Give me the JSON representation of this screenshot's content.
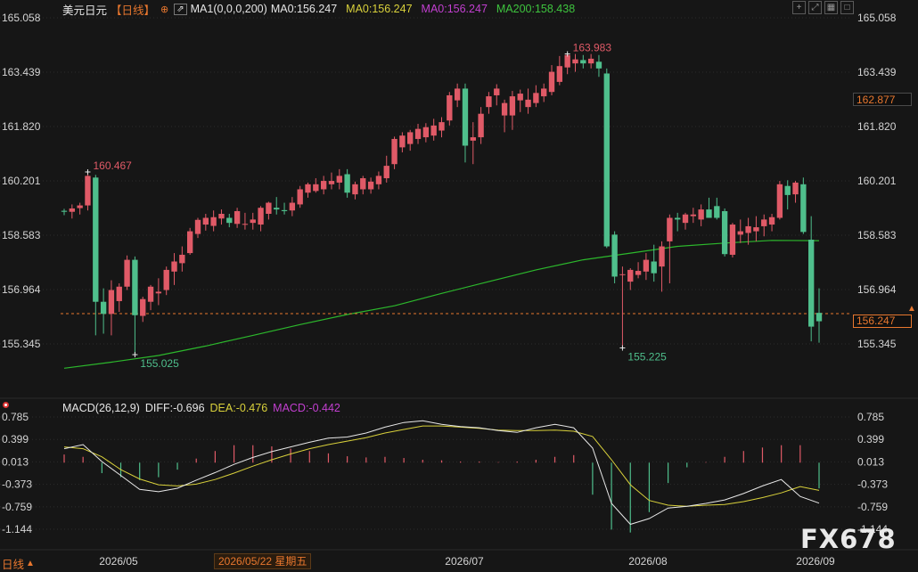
{
  "header": {
    "symbol": "美元日元",
    "period_label": "【日线】",
    "ma_params": "MA1(0,0,0,200)",
    "ma0": "MA0:156.247",
    "ma50": "MA0:156.247",
    "ma100": "MA0:156.247",
    "ma200": "MA200:158.438",
    "ma50_text": "MA0:156.247"
  },
  "header_items": [
    "MA0:156.247",
    "MA0:156.247",
    "MA0:156.247",
    "MA200:158.438"
  ],
  "header_colors": [
    "#e6e6e6",
    "#d9d13b",
    "#c23fd0",
    "#3ec43e"
  ],
  "macd_header": {
    "title": "MACD(26,12,9)",
    "diff": "DIFF:-0.696",
    "dea": "DEA:-0.476",
    "macd": "MACD:-0.442"
  },
  "footer": {
    "period": "日线",
    "crosshair_date": "2026/05/22 星期五",
    "watermark": "FX678"
  },
  "price_badges": {
    "last": "162.877",
    "current": "156.247"
  },
  "colors": {
    "background": "#161616",
    "up": "#e05a67",
    "down": "#4fbf8c",
    "ma200": "#2cb82c",
    "diff": "#e8e8e8",
    "dea": "#d9d13b",
    "accent": "#e8772e",
    "grid": "#2c2c2c"
  },
  "toolbar_icons": [
    "crosshair-icon",
    "expand-icon",
    "layout-icon",
    "maximize-icon"
  ],
  "chart_data": [
    {
      "type": "candlestick",
      "title": "美元日元 日线",
      "y_ticks": [
        165.058,
        163.439,
        161.82,
        160.201,
        158.583,
        156.964,
        155.345
      ],
      "ylim": [
        155.345,
        165.058
      ],
      "x_ticks": [
        "2026/05",
        "2026/07",
        "2026/08",
        "2026/09"
      ],
      "annotations": [
        {
          "label": "160.467",
          "value": 160.467,
          "kind": "high"
        },
        {
          "label": "155.025",
          "value": 155.025,
          "kind": "low"
        },
        {
          "label": "163.983",
          "value": 163.983,
          "kind": "high"
        },
        {
          "label": "155.225",
          "value": 155.225,
          "kind": "low"
        }
      ],
      "current_price": 156.247,
      "last_price_marker": 162.877,
      "candles": [
        [
          159.31,
          159.37,
          159.18,
          159.28
        ],
        [
          159.28,
          159.5,
          159.08,
          159.38
        ],
        [
          159.39,
          159.55,
          159.2,
          159.47
        ],
        [
          159.47,
          160.47,
          159.32,
          160.35
        ],
        [
          160.3,
          160.38,
          155.6,
          156.6
        ],
        [
          156.6,
          157.0,
          155.65,
          156.24
        ],
        [
          156.24,
          157.24,
          155.6,
          156.95
        ],
        [
          156.62,
          157.15,
          156.3,
          157.05
        ],
        [
          157.05,
          157.98,
          156.95,
          157.85
        ],
        [
          157.85,
          157.95,
          155.02,
          156.2
        ],
        [
          156.18,
          156.75,
          156.0,
          156.68
        ],
        [
          156.6,
          157.1,
          156.35,
          157.05
        ],
        [
          156.85,
          157.3,
          156.5,
          156.9
        ],
        [
          156.95,
          157.65,
          156.8,
          157.55
        ],
        [
          157.5,
          158.05,
          157.1,
          157.8
        ],
        [
          157.75,
          158.25,
          157.5,
          158.0
        ],
        [
          158.05,
          158.8,
          158.0,
          158.7
        ],
        [
          158.62,
          159.1,
          158.5,
          159.04
        ],
        [
          158.9,
          159.22,
          158.72,
          159.1
        ],
        [
          158.86,
          159.32,
          158.7,
          159.12
        ],
        [
          159.08,
          159.35,
          158.9,
          159.22
        ],
        [
          159.1,
          159.22,
          158.82,
          158.95
        ],
        [
          158.92,
          159.4,
          158.8,
          159.3
        ],
        [
          158.9,
          159.25,
          158.75,
          158.92
        ],
        [
          158.95,
          159.25,
          158.75,
          159.05
        ],
        [
          158.9,
          159.45,
          158.7,
          159.4
        ],
        [
          159.22,
          159.58,
          159.05,
          159.55
        ],
        [
          159.4,
          159.72,
          159.2,
          159.35
        ],
        [
          159.33,
          159.55,
          159.2,
          159.3
        ],
        [
          159.32,
          159.72,
          159.15,
          159.55
        ],
        [
          159.5,
          160.05,
          159.4,
          159.95
        ],
        [
          159.85,
          160.15,
          159.7,
          160.1
        ],
        [
          159.9,
          160.28,
          159.85,
          160.1
        ],
        [
          159.95,
          160.35,
          159.8,
          160.2
        ],
        [
          160.1,
          160.45,
          159.95,
          160.2
        ],
        [
          160.15,
          160.55,
          159.95,
          160.35
        ],
        [
          160.4,
          160.55,
          159.7,
          159.85
        ],
        [
          159.8,
          160.18,
          159.65,
          160.1
        ],
        [
          159.95,
          160.35,
          159.8,
          160.28
        ],
        [
          159.95,
          160.3,
          159.82,
          160.18
        ],
        [
          160.1,
          160.48,
          159.95,
          160.35
        ],
        [
          160.28,
          160.95,
          160.15,
          160.65
        ],
        [
          160.7,
          161.52,
          160.55,
          161.45
        ],
        [
          161.2,
          161.65,
          161.05,
          161.55
        ],
        [
          161.3,
          161.72,
          161.1,
          161.65
        ],
        [
          161.45,
          161.9,
          161.3,
          161.75
        ],
        [
          161.5,
          161.92,
          161.35,
          161.8
        ],
        [
          161.55,
          162.05,
          161.4,
          161.85
        ],
        [
          161.7,
          162.1,
          161.5,
          161.95
        ],
        [
          162.0,
          162.85,
          161.85,
          162.75
        ],
        [
          162.6,
          163.1,
          162.4,
          162.95
        ],
        [
          162.95,
          163.1,
          160.75,
          161.25
        ],
        [
          161.4,
          161.95,
          160.7,
          161.5
        ],
        [
          161.5,
          162.4,
          161.3,
          162.2
        ],
        [
          162.4,
          162.85,
          162.2,
          162.72
        ],
        [
          162.75,
          163.08,
          162.45,
          162.95
        ],
        [
          162.15,
          162.62,
          161.65,
          162.52
        ],
        [
          162.15,
          162.88,
          161.72,
          162.72
        ],
        [
          162.6,
          162.92,
          162.25,
          162.8
        ],
        [
          162.4,
          162.95,
          162.2,
          162.62
        ],
        [
          162.52,
          163.05,
          162.4,
          162.82
        ],
        [
          162.72,
          163.1,
          162.55,
          162.95
        ],
        [
          162.85,
          163.65,
          162.75,
          163.45
        ],
        [
          163.15,
          163.92,
          163.05,
          163.62
        ],
        [
          163.58,
          163.98,
          163.38,
          163.95
        ],
        [
          163.7,
          163.98,
          163.45,
          163.82
        ],
        [
          163.8,
          163.95,
          163.55,
          163.7
        ],
        [
          163.7,
          163.98,
          163.55,
          163.84
        ],
        [
          163.75,
          163.95,
          163.3,
          163.55
        ],
        [
          163.4,
          163.55,
          158.2,
          158.25
        ],
        [
          158.6,
          158.7,
          157.15,
          157.35
        ],
        [
          157.4,
          157.65,
          155.22,
          157.42
        ],
        [
          157.2,
          157.6,
          156.95,
          157.55
        ],
        [
          157.4,
          157.78,
          157.3,
          157.52
        ],
        [
          157.5,
          158.05,
          157.25,
          157.85
        ],
        [
          157.8,
          158.3,
          157.2,
          157.45
        ],
        [
          157.65,
          158.4,
          156.9,
          158.25
        ],
        [
          158.4,
          159.2,
          157.15,
          159.1
        ],
        [
          159.1,
          159.25,
          158.7,
          159.05
        ],
        [
          158.95,
          159.25,
          158.75,
          159.2
        ],
        [
          159.15,
          159.4,
          158.95,
          159.2
        ],
        [
          159.05,
          159.5,
          158.85,
          159.35
        ],
        [
          159.35,
          159.7,
          159.1,
          159.1
        ],
        [
          159.45,
          159.7,
          159.05,
          159.1
        ],
        [
          159.3,
          159.38,
          157.95,
          158.02
        ],
        [
          158.0,
          158.95,
          157.92,
          158.9
        ],
        [
          158.6,
          159.05,
          158.35,
          158.7
        ],
        [
          158.65,
          159.1,
          158.3,
          158.85
        ],
        [
          158.7,
          159.15,
          158.4,
          158.82
        ],
        [
          158.85,
          159.2,
          158.55,
          159.05
        ],
        [
          158.9,
          159.22,
          158.7,
          159.12
        ],
        [
          159.1,
          160.2,
          159.05,
          160.1
        ],
        [
          160.05,
          160.22,
          159.35,
          159.78
        ],
        [
          159.8,
          160.2,
          159.55,
          160.15
        ],
        [
          160.1,
          160.3,
          158.62,
          158.68
        ],
        [
          158.45,
          159.15,
          155.42,
          155.86
        ],
        [
          156.27,
          157.0,
          155.38,
          156.02
        ]
      ],
      "ma200": [
        154.62,
        154.8,
        155.0,
        155.28,
        155.6,
        155.92,
        156.22,
        156.48,
        156.85,
        157.2,
        157.55,
        157.85,
        158.05,
        158.25,
        158.35,
        158.43,
        158.42
      ]
    },
    {
      "type": "line",
      "title": "MACD(26,12,9)",
      "y_ticks": [
        0.785,
        0.399,
        0.013,
        -0.373,
        -0.759,
        -1.144
      ],
      "ylim": [
        -1.144,
        0.785
      ],
      "series": [
        {
          "name": "DIFF",
          "values": [
            0.24,
            0.31,
            0.02,
            -0.22,
            -0.46,
            -0.5,
            -0.44,
            -0.3,
            -0.17,
            -0.03,
            0.09,
            0.19,
            0.27,
            0.35,
            0.42,
            0.44,
            0.51,
            0.61,
            0.69,
            0.72,
            0.66,
            0.62,
            0.6,
            0.55,
            0.52,
            0.6,
            0.66,
            0.6,
            0.25,
            -0.7,
            -1.06,
            -0.96,
            -0.78,
            -0.75,
            -0.7,
            -0.64,
            -0.53,
            -0.4,
            -0.29,
            -0.58,
            -0.696
          ]
        },
        {
          "name": "DEA",
          "values": [
            0.27,
            0.24,
            0.1,
            -0.12,
            -0.28,
            -0.38,
            -0.4,
            -0.37,
            -0.29,
            -0.18,
            -0.06,
            0.05,
            0.15,
            0.24,
            0.31,
            0.37,
            0.43,
            0.51,
            0.57,
            0.63,
            0.63,
            0.61,
            0.59,
            0.56,
            0.55,
            0.55,
            0.56,
            0.54,
            0.45,
            0.05,
            -0.38,
            -0.65,
            -0.73,
            -0.75,
            -0.73,
            -0.72,
            -0.67,
            -0.6,
            -0.52,
            -0.41,
            -0.476
          ]
        },
        {
          "name": "MACD",
          "values": [
            0.14,
            0.1,
            -0.18,
            -0.25,
            -0.3,
            -0.25,
            -0.12,
            0.07,
            0.2,
            0.3,
            0.3,
            0.28,
            0.24,
            0.2,
            0.16,
            0.11,
            0.09,
            0.1,
            0.08,
            0.05,
            0.04,
            0.02,
            0.02,
            0.01,
            0.02,
            0.05,
            0.1,
            0.13,
            -0.55,
            -1.15,
            -1.2,
            -0.85,
            -0.35,
            -0.08,
            0.01,
            0.1,
            0.2,
            0.26,
            0.3,
            0.3,
            -0.442
          ]
        }
      ],
      "x_ticks": [
        "2026/05",
        "2026/07",
        "2026/08",
        "2026/09"
      ]
    }
  ]
}
